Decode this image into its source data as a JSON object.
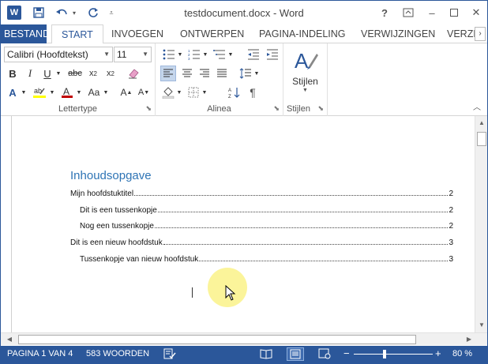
{
  "window": {
    "title": "testdocument.docx - Word",
    "qat": {
      "app_icon": "W"
    },
    "controls": {
      "help": "?",
      "minimize": "–",
      "close": "✕"
    }
  },
  "tabs": [
    {
      "label": "BESTAND"
    },
    {
      "label": "START"
    },
    {
      "label": "INVOEGEN"
    },
    {
      "label": "ONTWERPEN"
    },
    {
      "label": "PAGINA-INDELING"
    },
    {
      "label": "VERWIJZINGEN"
    },
    {
      "label": "VERZEN"
    }
  ],
  "ribbon": {
    "font": {
      "family": "Calibri (Hoofdtekst)",
      "size": "11",
      "group_label": "Lettertype"
    },
    "paragraph": {
      "group_label": "Alinea"
    },
    "styles": {
      "button_label": "Stijlen",
      "group_label": "Stijlen"
    }
  },
  "document": {
    "toc_title": "Inhoudsopgave",
    "toc_entries": [
      {
        "text": "Mijn hoofdstuktitel",
        "page": "2"
      },
      {
        "text": "Dit is een tussenkopje",
        "page": "2"
      },
      {
        "text": "Nog een tussenkopje",
        "page": "2"
      },
      {
        "text": "Dit is een nieuw hoofdstuk",
        "page": "3"
      },
      {
        "text": "Tussenkopje van nieuw hoofdstuk",
        "page": "3"
      }
    ]
  },
  "status": {
    "page": "PAGINA 1 VAN 4",
    "words": "583 WOORDEN",
    "zoom": "80 %",
    "zoom_level": 0.8
  },
  "colors": {
    "accent": "#2b579a",
    "heading": "#2e74b5",
    "pointer_highlight": "#faf078"
  }
}
